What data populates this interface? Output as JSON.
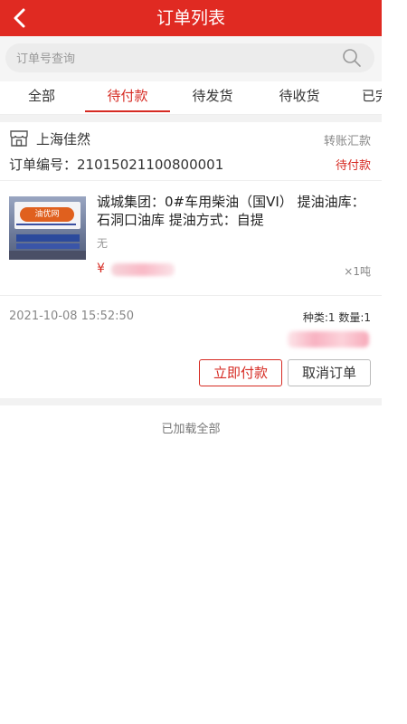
{
  "header": {
    "title": "订单列表",
    "back_icon": "back-arrow-icon",
    "bg_color": "#e02a22"
  },
  "search": {
    "placeholder": "订单号查询",
    "value": ""
  },
  "tabs": [
    {
      "label": "全部",
      "active": false
    },
    {
      "label": "待付款",
      "active": true
    },
    {
      "label": "待发货",
      "active": false
    },
    {
      "label": "待收货",
      "active": false
    },
    {
      "label": "已完成",
      "active": false
    }
  ],
  "order": {
    "shop_name": "上海佳然",
    "payment_method": "转账汇款",
    "order_number_label": "订单编号：21015021100800001",
    "status": "待付款",
    "product": {
      "image_logo_text": "油优网",
      "title": "诚城集团：0#车用柴油（国VI） 提油油库：石洞口油库   提油方式：自提",
      "spec": "无",
      "price_symbol": "¥",
      "quantity": "×1吨"
    },
    "time": "2021-10-08 15:52:50",
    "summary": "种类:1  数量:1",
    "buttons": {
      "pay": "立即付款",
      "cancel": "取消订单"
    }
  },
  "footer": {
    "loaded_all": "已加载全部"
  },
  "colors": {
    "accent": "#d62a22"
  }
}
